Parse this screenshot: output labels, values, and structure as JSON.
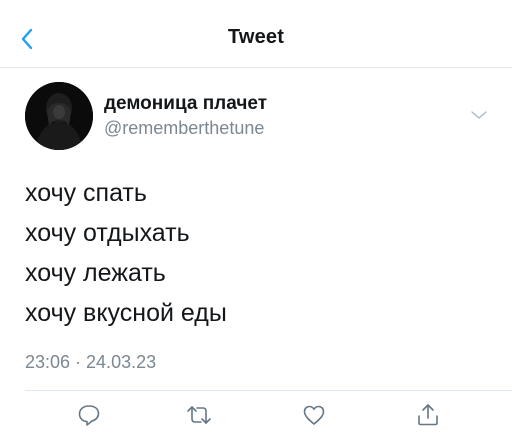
{
  "header": {
    "title": "Tweet",
    "back_icon": "chevron-left-icon",
    "accent": "#1da1f2"
  },
  "tweet": {
    "author": {
      "display_name": "демоница плачет",
      "handle": "@rememberthetune"
    },
    "more_icon": "chevron-down-icon",
    "lines": [
      "хочу спать",
      "хочу отдыхать",
      "хочу лежать",
      "хочу вкусной еды"
    ],
    "timestamp": "23:06 · 24.03.23"
  },
  "actions": [
    {
      "icon": "reply-icon"
    },
    {
      "icon": "retweet-icon"
    },
    {
      "icon": "like-icon"
    },
    {
      "icon": "share-icon"
    }
  ],
  "colors": {
    "text": "#14171a",
    "secondary": "#7b8791",
    "divider": "#e1e8ed"
  }
}
